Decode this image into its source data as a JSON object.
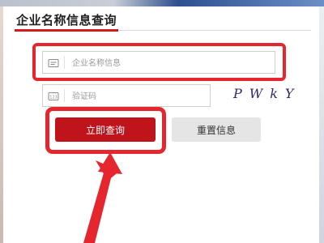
{
  "header": {
    "title": "企业名称信息查询"
  },
  "form": {
    "company": {
      "placeholder": "企业名称信息",
      "icon": "id-card-icon"
    },
    "captcha": {
      "placeholder": "验证码",
      "icon": "captcha-icon",
      "code": "PWkY"
    }
  },
  "buttons": {
    "query_label": "立即查询",
    "reset_label": "重置信息"
  },
  "colors": {
    "accent_red": "#e5262e",
    "button_red": "#bf141b",
    "button_gray": "#e5e5e5"
  }
}
